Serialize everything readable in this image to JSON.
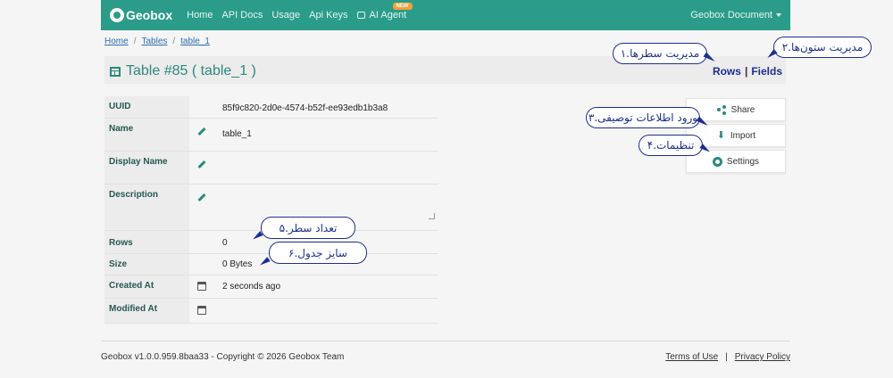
{
  "navbar": {
    "brand": "Geobox",
    "items": [
      "Home",
      "API Docs",
      "Usage",
      "Api Keys",
      "AI Agent"
    ],
    "new_badge": "NEW",
    "right_menu": "Geobox Document"
  },
  "breadcrumb": [
    "Home",
    "Tables",
    "table_1"
  ],
  "page": {
    "title": "Table #85 ( table_1 )",
    "link_rows": "Rows",
    "link_sep": "|",
    "link_fields": "Fields"
  },
  "properties": {
    "uuid_label": "UUID",
    "uuid_value": "85f9c820-2d0e-4574-b52f-ee93edb1b3a8",
    "name_label": "Name",
    "name_value": "table_1",
    "display_name_label": "Display Name",
    "display_name_value": "",
    "description_label": "Description",
    "description_value": "",
    "rows_label": "Rows",
    "rows_value": "0",
    "size_label": "Size",
    "size_value": "0 Bytes",
    "created_label": "Created At",
    "created_value": "2 seconds ago",
    "modified_label": "Modified At",
    "modified_value": ""
  },
  "actions": {
    "share": "Share",
    "import": "Import",
    "settings": "Settings"
  },
  "callouts": {
    "rows": "۱.مدیریت سطرها",
    "fields": "۲.مدیریت ستون‌ها",
    "import": "۳.ورود اطلاعات توصیفی",
    "settings": "۴.تنظیمات",
    "row_count": "۵.تعداد سطر",
    "table_size": "۶.سایز جدول"
  },
  "footer": {
    "copyright": "Geobox v1.0.0.959.8baa33 - Copyright © 2026 Geobox Team",
    "terms": "Terms of Use",
    "sep": "|",
    "privacy": "Privacy Policy"
  },
  "colors": {
    "brand": "#2b9c8a",
    "accent_text": "#2a8a7d",
    "annotation": "#1c2f8f"
  }
}
